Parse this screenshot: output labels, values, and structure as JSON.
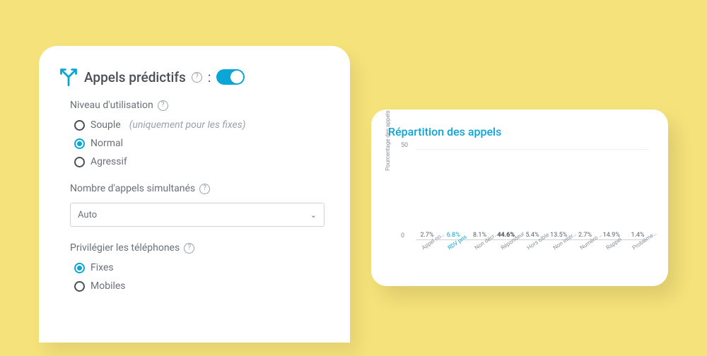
{
  "settings": {
    "title": "Appels prédictifs",
    "toggle_on": true,
    "level": {
      "label": "Niveau d'utilisation",
      "options": {
        "souple": {
          "label": "Souple",
          "hint": "(uniquement pour les fixes)"
        },
        "normal": {
          "label": "Normal"
        },
        "agressif": {
          "label": "Agressif"
        }
      },
      "selected": "normal"
    },
    "simultaneous": {
      "label": "Nombre d'appels simultanés",
      "value": "Auto"
    },
    "prefer": {
      "label": "Privilégier les téléphones",
      "options": {
        "fixes": "Fixes",
        "mobiles": "Mobiles"
      },
      "selected": "fixes"
    }
  },
  "chart_data": {
    "type": "bar",
    "title": "Répartition des appels",
    "ylabel": "Pourcentage des appels",
    "ylim": [
      0,
      50
    ],
    "ticks": [
      0,
      50
    ],
    "categories": [
      "Appel no…",
      "RDV pris",
      "Non décr…",
      "Répondeur",
      "Hors cible",
      "Non intér…",
      "Numéro …",
      "Rappel",
      "Problème…"
    ],
    "values": [
      2.7,
      6.8,
      8.1,
      44.6,
      5.4,
      13.5,
      2.7,
      14.9,
      1.4
    ],
    "value_labels": [
      "2.7%",
      "6.8%",
      "8.1%",
      "44.6%",
      "5.4%",
      "13.5%",
      "2.7%",
      "14.9%",
      "1.4%"
    ],
    "colors": [
      "#e23b3b",
      "#0aa6d6",
      "#f19a2a",
      "#f7c600",
      "#8a5fa3",
      "#c7c98c",
      "#bfbfbf",
      "#0aa6d6",
      "#bfbfbf"
    ],
    "highlight_index": 1,
    "max_index": 3
  }
}
